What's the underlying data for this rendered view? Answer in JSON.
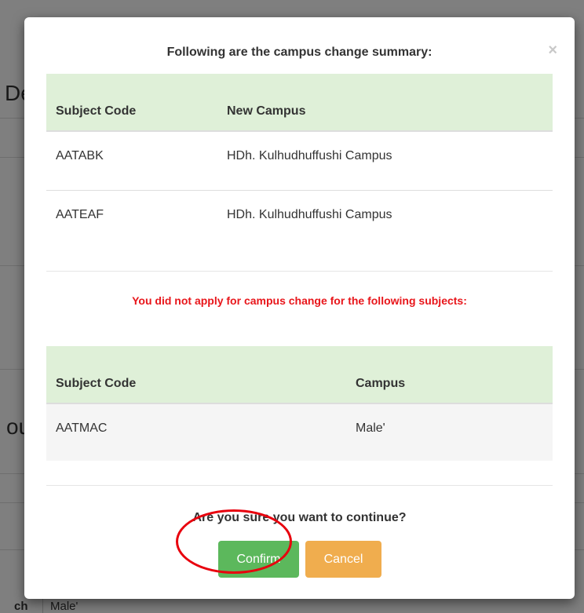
{
  "background": {
    "fragment_top": "De",
    "fragment_mid": "ou",
    "row_label": "ch",
    "row_value": "Male'"
  },
  "modal": {
    "title": "Following are the campus change summary:",
    "close_glyph": "×",
    "applied_table": {
      "headers": [
        "Subject Code",
        "New Campus"
      ],
      "rows": [
        [
          "AATABK",
          "HDh. Kulhudhuffushi Campus"
        ],
        [
          "AATEAF",
          "HDh. Kulhudhuffushi Campus"
        ]
      ]
    },
    "warning": "You did not apply for campus change for the following subjects:",
    "not_applied_table": {
      "headers": [
        "Subject Code",
        "Campus"
      ],
      "rows": [
        [
          "AATMAC",
          "Male'"
        ]
      ]
    },
    "question": "Are you sure you want to continue?",
    "confirm_label": "Confirm",
    "cancel_label": "Cancel"
  },
  "colors": {
    "header_bg": "#dff0d8",
    "warning_text": "#e8161b",
    "confirm_bg": "#5cb85c",
    "cancel_bg": "#f0ad4e",
    "highlight": "#e8000d"
  }
}
